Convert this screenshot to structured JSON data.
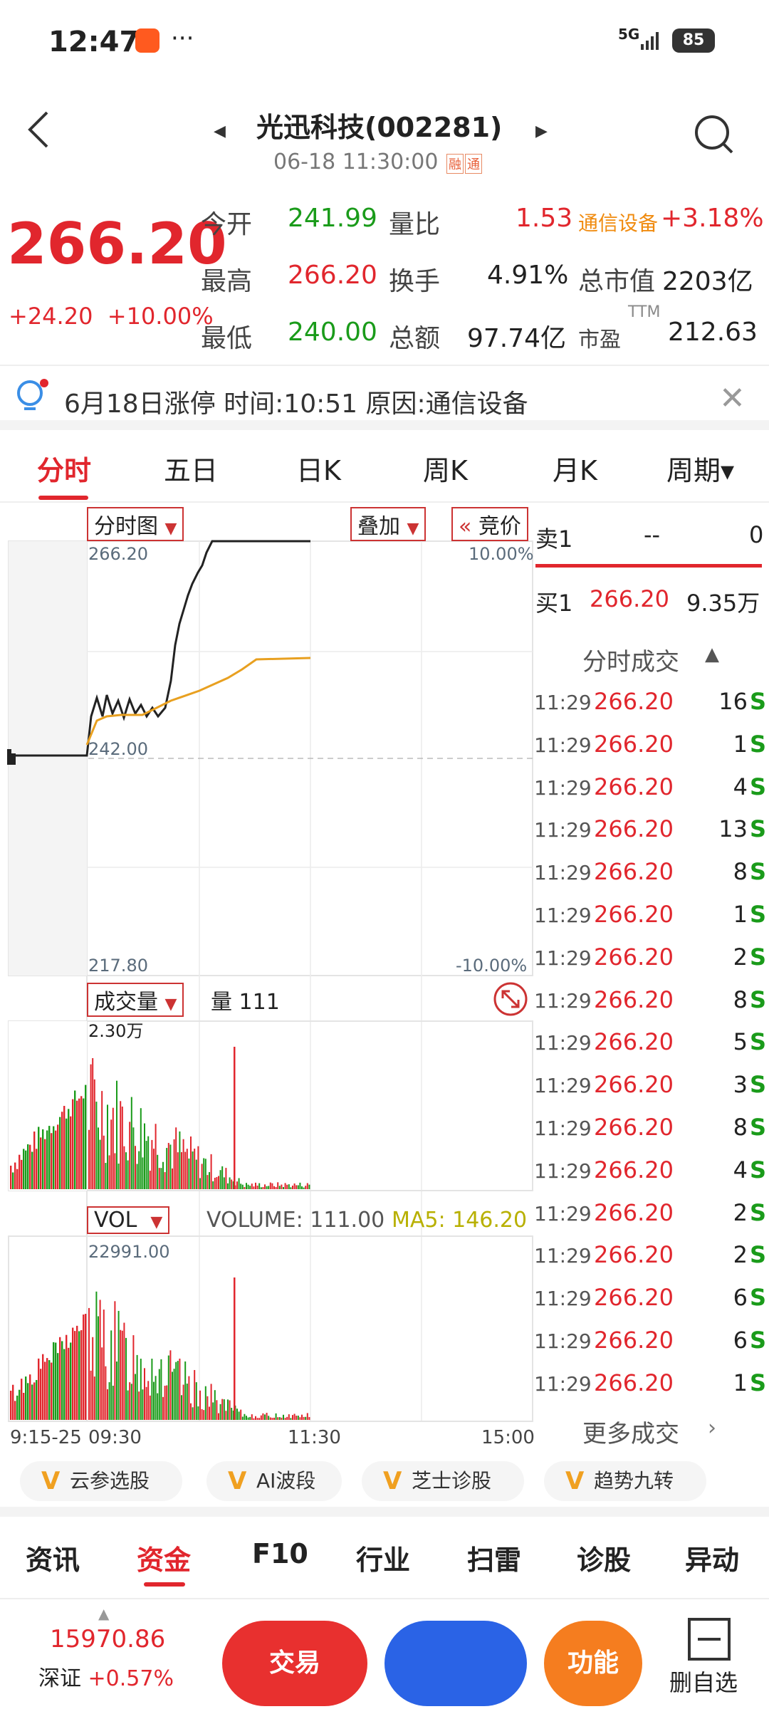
{
  "status": {
    "time": "12:47",
    "dots": "···",
    "signal": "5G",
    "battery": "85"
  },
  "header": {
    "title": "光迅科技(002281)",
    "datetime": "06-18 11:30:00",
    "tag1": "融",
    "tag2": "通"
  },
  "quote": {
    "price": "266.20",
    "change": "+24.20",
    "change_pct": "+10.00%",
    "open_label": "今开",
    "open": "241.99",
    "high_label": "最高",
    "high": "266.20",
    "low_label": "最低",
    "low": "240.00",
    "vr_label": "量比",
    "vr": "1.53",
    "turnover_label": "换手",
    "turnover": "4.91%",
    "amount_label": "总额",
    "amount": "97.74亿",
    "industry": "通信设备",
    "industry_pct": "+3.18%",
    "mcap_label": "总市值",
    "mcap": "2203亿",
    "pe_label": "市盈",
    "pe_sup": "TTM",
    "pe": "212.63"
  },
  "notice": {
    "text": "6月18日涨停  时间:10:51  原因:通信设备"
  },
  "tabs": [
    "分时",
    "五日",
    "日K",
    "周K",
    "月K",
    "周期▾"
  ],
  "chart": {
    "dd_main": "分时图",
    "dd_overlay": "叠加",
    "dd_auction": "竞价",
    "y_top": "266.20",
    "y_mid": "242.00",
    "y_bot": "217.80",
    "pct_top": "10.00%",
    "pct_bot": "-10.00%",
    "vol_dd": "成交量",
    "vol_label": "量 111",
    "vol_max": "2.30万",
    "ind_dd": "VOL",
    "ind_label": "VOLUME: 111.00",
    "ind_ma": "MA5: 146.20",
    "ind_max": "22991.00",
    "x_labels": [
      "9:15-25",
      "09:30",
      "11:30",
      "15:00"
    ]
  },
  "right": {
    "sell1_label": "卖1",
    "sell1_price": "--",
    "sell1_vol": "0",
    "buy1_label": "买1",
    "buy1_price": "266.20",
    "buy1_vol": "9.35万",
    "ticks_title": "分时成交",
    "ticks": [
      {
        "t": "11:29",
        "p": "266.20",
        "v": "16",
        "s": "S"
      },
      {
        "t": "11:29",
        "p": "266.20",
        "v": "1",
        "s": "S"
      },
      {
        "t": "11:29",
        "p": "266.20",
        "v": "4",
        "s": "S"
      },
      {
        "t": "11:29",
        "p": "266.20",
        "v": "13",
        "s": "S"
      },
      {
        "t": "11:29",
        "p": "266.20",
        "v": "8",
        "s": "S"
      },
      {
        "t": "11:29",
        "p": "266.20",
        "v": "1",
        "s": "S"
      },
      {
        "t": "11:29",
        "p": "266.20",
        "v": "2",
        "s": "S"
      },
      {
        "t": "11:29",
        "p": "266.20",
        "v": "8",
        "s": "S"
      },
      {
        "t": "11:29",
        "p": "266.20",
        "v": "5",
        "s": "S"
      },
      {
        "t": "11:29",
        "p": "266.20",
        "v": "3",
        "s": "S"
      },
      {
        "t": "11:29",
        "p": "266.20",
        "v": "8",
        "s": "S"
      },
      {
        "t": "11:29",
        "p": "266.20",
        "v": "4",
        "s": "S"
      },
      {
        "t": "11:29",
        "p": "266.20",
        "v": "2",
        "s": "S"
      },
      {
        "t": "11:29",
        "p": "266.20",
        "v": "2",
        "s": "S"
      },
      {
        "t": "11:29",
        "p": "266.20",
        "v": "6",
        "s": "S"
      },
      {
        "t": "11:29",
        "p": "266.20",
        "v": "6",
        "s": "S"
      },
      {
        "t": "11:29",
        "p": "266.20",
        "v": "1",
        "s": "S"
      }
    ],
    "more": "更多成交"
  },
  "pills": [
    "云参选股",
    "AI波段",
    "芝士诊股",
    "趋势九转"
  ],
  "bottom_tabs": [
    "资讯",
    "资金",
    "F10",
    "行业",
    "扫雷",
    "诊股",
    "异动"
  ],
  "footer": {
    "index_value": "15970.86",
    "index_name": "深证",
    "index_pct": "+0.57%",
    "trade": "交易",
    "func": "功能",
    "del": "删自选"
  },
  "colors": {
    "red": "#e1262d",
    "green": "#1a9b1a",
    "blue": "#2a63e6",
    "orange": "#f57d1f"
  }
}
